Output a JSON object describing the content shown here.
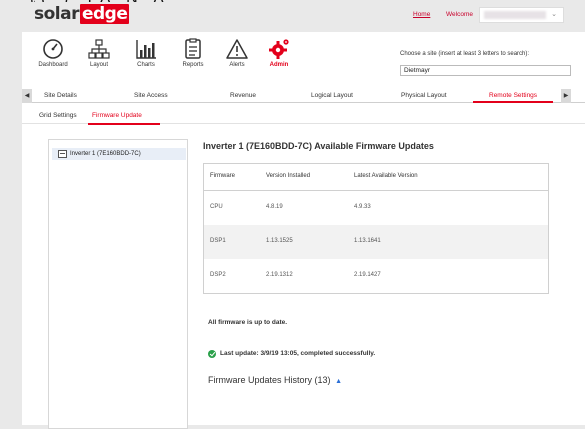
{
  "header": {
    "logo_main": "solar",
    "logo_accent": "edge",
    "home_link": "Home",
    "welcome_label": "Welcome",
    "user_chevron": "⌄"
  },
  "nav": [
    {
      "label": "Dashboard",
      "icon": "gauge-icon"
    },
    {
      "label": "Layout",
      "icon": "network-icon"
    },
    {
      "label": "Charts",
      "icon": "bar-chart-icon"
    },
    {
      "label": "Reports",
      "icon": "report-icon"
    },
    {
      "label": "Alerts",
      "icon": "warning-icon"
    },
    {
      "label": "Admin",
      "icon": "gear-icon",
      "active": true
    }
  ],
  "site_search": {
    "label": "Choose a site (insert at least 3 letters to search):",
    "value": "Dietmayr"
  },
  "tabs": [
    {
      "label": "Site Details"
    },
    {
      "label": "Site Access"
    },
    {
      "label": "Revenue"
    },
    {
      "label": "Logical Layout"
    },
    {
      "label": "Physical Layout"
    },
    {
      "label": "Remote Settings",
      "active": true
    }
  ],
  "subtabs": [
    {
      "label": "Grid Settings"
    },
    {
      "label": "Firmware Update",
      "active": true
    }
  ],
  "inverter_list": [
    {
      "label": "Inverter 1 (7E160BDD-7C)"
    }
  ],
  "content": {
    "title": "Inverter 1 (7E160BDD-7C) Available Firmware Updates",
    "table": {
      "headers": [
        "Firmware",
        "Version Installed",
        "Latest Available Version"
      ],
      "rows": [
        [
          "CPU",
          "4.8.19",
          "4.9.33"
        ],
        [
          "DSP1",
          "1.13.1525",
          "1.13.1641"
        ],
        [
          "DSP2",
          "2.19.1312",
          "2.19.1427"
        ]
      ]
    },
    "status": "All firmware is up to date.",
    "last_update": "Last update: 3/9/19 13:05, completed successfully.",
    "history_title": "Firmware Updates History",
    "history_count": "(13)",
    "history_toggle": "▲"
  },
  "colors": {
    "brand_red": "#e3001b",
    "success_green": "#2aa04a",
    "link_blue": "#2b6fd6"
  }
}
